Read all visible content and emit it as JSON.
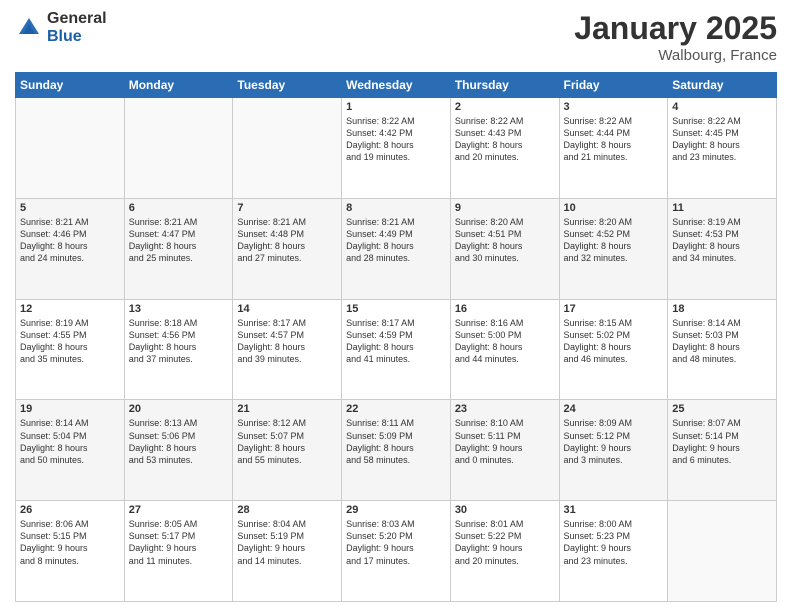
{
  "header": {
    "logo_general": "General",
    "logo_blue": "Blue",
    "title": "January 2025",
    "location": "Walbourg, France"
  },
  "days_of_week": [
    "Sunday",
    "Monday",
    "Tuesday",
    "Wednesday",
    "Thursday",
    "Friday",
    "Saturday"
  ],
  "weeks": [
    [
      {
        "day": "",
        "sunrise": "",
        "sunset": "",
        "daylight": ""
      },
      {
        "day": "",
        "sunrise": "",
        "sunset": "",
        "daylight": ""
      },
      {
        "day": "",
        "sunrise": "",
        "sunset": "",
        "daylight": ""
      },
      {
        "day": "1",
        "sunrise": "Sunrise: 8:22 AM",
        "sunset": "Sunset: 4:42 PM",
        "daylight": "Daylight: 8 hours and 19 minutes."
      },
      {
        "day": "2",
        "sunrise": "Sunrise: 8:22 AM",
        "sunset": "Sunset: 4:43 PM",
        "daylight": "Daylight: 8 hours and 20 minutes."
      },
      {
        "day": "3",
        "sunrise": "Sunrise: 8:22 AM",
        "sunset": "Sunset: 4:44 PM",
        "daylight": "Daylight: 8 hours and 21 minutes."
      },
      {
        "day": "4",
        "sunrise": "Sunrise: 8:22 AM",
        "sunset": "Sunset: 4:45 PM",
        "daylight": "Daylight: 8 hours and 23 minutes."
      }
    ],
    [
      {
        "day": "5",
        "sunrise": "Sunrise: 8:21 AM",
        "sunset": "Sunset: 4:46 PM",
        "daylight": "Daylight: 8 hours and 24 minutes."
      },
      {
        "day": "6",
        "sunrise": "Sunrise: 8:21 AM",
        "sunset": "Sunset: 4:47 PM",
        "daylight": "Daylight: 8 hours and 25 minutes."
      },
      {
        "day": "7",
        "sunrise": "Sunrise: 8:21 AM",
        "sunset": "Sunset: 4:48 PM",
        "daylight": "Daylight: 8 hours and 27 minutes."
      },
      {
        "day": "8",
        "sunrise": "Sunrise: 8:21 AM",
        "sunset": "Sunset: 4:49 PM",
        "daylight": "Daylight: 8 hours and 28 minutes."
      },
      {
        "day": "9",
        "sunrise": "Sunrise: 8:20 AM",
        "sunset": "Sunset: 4:51 PM",
        "daylight": "Daylight: 8 hours and 30 minutes."
      },
      {
        "day": "10",
        "sunrise": "Sunrise: 8:20 AM",
        "sunset": "Sunset: 4:52 PM",
        "daylight": "Daylight: 8 hours and 32 minutes."
      },
      {
        "day": "11",
        "sunrise": "Sunrise: 8:19 AM",
        "sunset": "Sunset: 4:53 PM",
        "daylight": "Daylight: 8 hours and 34 minutes."
      }
    ],
    [
      {
        "day": "12",
        "sunrise": "Sunrise: 8:19 AM",
        "sunset": "Sunset: 4:55 PM",
        "daylight": "Daylight: 8 hours and 35 minutes."
      },
      {
        "day": "13",
        "sunrise": "Sunrise: 8:18 AM",
        "sunset": "Sunset: 4:56 PM",
        "daylight": "Daylight: 8 hours and 37 minutes."
      },
      {
        "day": "14",
        "sunrise": "Sunrise: 8:17 AM",
        "sunset": "Sunset: 4:57 PM",
        "daylight": "Daylight: 8 hours and 39 minutes."
      },
      {
        "day": "15",
        "sunrise": "Sunrise: 8:17 AM",
        "sunset": "Sunset: 4:59 PM",
        "daylight": "Daylight: 8 hours and 41 minutes."
      },
      {
        "day": "16",
        "sunrise": "Sunrise: 8:16 AM",
        "sunset": "Sunset: 5:00 PM",
        "daylight": "Daylight: 8 hours and 44 minutes."
      },
      {
        "day": "17",
        "sunrise": "Sunrise: 8:15 AM",
        "sunset": "Sunset: 5:02 PM",
        "daylight": "Daylight: 8 hours and 46 minutes."
      },
      {
        "day": "18",
        "sunrise": "Sunrise: 8:14 AM",
        "sunset": "Sunset: 5:03 PM",
        "daylight": "Daylight: 8 hours and 48 minutes."
      }
    ],
    [
      {
        "day": "19",
        "sunrise": "Sunrise: 8:14 AM",
        "sunset": "Sunset: 5:04 PM",
        "daylight": "Daylight: 8 hours and 50 minutes."
      },
      {
        "day": "20",
        "sunrise": "Sunrise: 8:13 AM",
        "sunset": "Sunset: 5:06 PM",
        "daylight": "Daylight: 8 hours and 53 minutes."
      },
      {
        "day": "21",
        "sunrise": "Sunrise: 8:12 AM",
        "sunset": "Sunset: 5:07 PM",
        "daylight": "Daylight: 8 hours and 55 minutes."
      },
      {
        "day": "22",
        "sunrise": "Sunrise: 8:11 AM",
        "sunset": "Sunset: 5:09 PM",
        "daylight": "Daylight: 8 hours and 58 minutes."
      },
      {
        "day": "23",
        "sunrise": "Sunrise: 8:10 AM",
        "sunset": "Sunset: 5:11 PM",
        "daylight": "Daylight: 9 hours and 0 minutes."
      },
      {
        "day": "24",
        "sunrise": "Sunrise: 8:09 AM",
        "sunset": "Sunset: 5:12 PM",
        "daylight": "Daylight: 9 hours and 3 minutes."
      },
      {
        "day": "25",
        "sunrise": "Sunrise: 8:07 AM",
        "sunset": "Sunset: 5:14 PM",
        "daylight": "Daylight: 9 hours and 6 minutes."
      }
    ],
    [
      {
        "day": "26",
        "sunrise": "Sunrise: 8:06 AM",
        "sunset": "Sunset: 5:15 PM",
        "daylight": "Daylight: 9 hours and 8 minutes."
      },
      {
        "day": "27",
        "sunrise": "Sunrise: 8:05 AM",
        "sunset": "Sunset: 5:17 PM",
        "daylight": "Daylight: 9 hours and 11 minutes."
      },
      {
        "day": "28",
        "sunrise": "Sunrise: 8:04 AM",
        "sunset": "Sunset: 5:19 PM",
        "daylight": "Daylight: 9 hours and 14 minutes."
      },
      {
        "day": "29",
        "sunrise": "Sunrise: 8:03 AM",
        "sunset": "Sunset: 5:20 PM",
        "daylight": "Daylight: 9 hours and 17 minutes."
      },
      {
        "day": "30",
        "sunrise": "Sunrise: 8:01 AM",
        "sunset": "Sunset: 5:22 PM",
        "daylight": "Daylight: 9 hours and 20 minutes."
      },
      {
        "day": "31",
        "sunrise": "Sunrise: 8:00 AM",
        "sunset": "Sunset: 5:23 PM",
        "daylight": "Daylight: 9 hours and 23 minutes."
      },
      {
        "day": "",
        "sunrise": "",
        "sunset": "",
        "daylight": ""
      }
    ]
  ]
}
